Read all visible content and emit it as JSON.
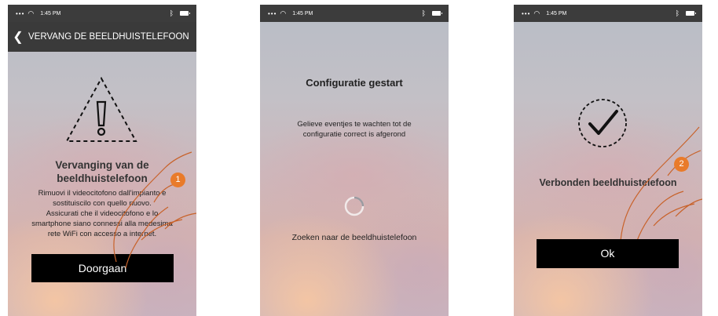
{
  "status_bar": {
    "time": "1:45 PM"
  },
  "screen1": {
    "title": "VERVANG DE BEELDHUISTELEFOON",
    "heading_line1": "Vervanging van de",
    "heading_line2": "beeldhuistelefoon",
    "body": [
      "Rimuovi il videocitofono dall'impianto e",
      "sostituiscilo con quello nuovo.",
      "Assicurati che il videocitofono e lo",
      "smartphone siano connessi alla medesima",
      "rete WiFi con accesso a internet."
    ],
    "button": "Doorgaan",
    "step": "1"
  },
  "screen2": {
    "heading": "Configuratie gestart",
    "body_line1": "Gelieve eventjes te wachten tot de",
    "body_line2": "configuratie correct is afgerond",
    "search": "Zoeken naar de beeldhuistelefoon"
  },
  "screen3": {
    "heading": "Verbonden beeldhuistelefoon",
    "button": "Ok",
    "step": "2"
  },
  "colors": {
    "badge": "#e97b2a",
    "bar": "#3a3a3a",
    "button": "#000000"
  }
}
